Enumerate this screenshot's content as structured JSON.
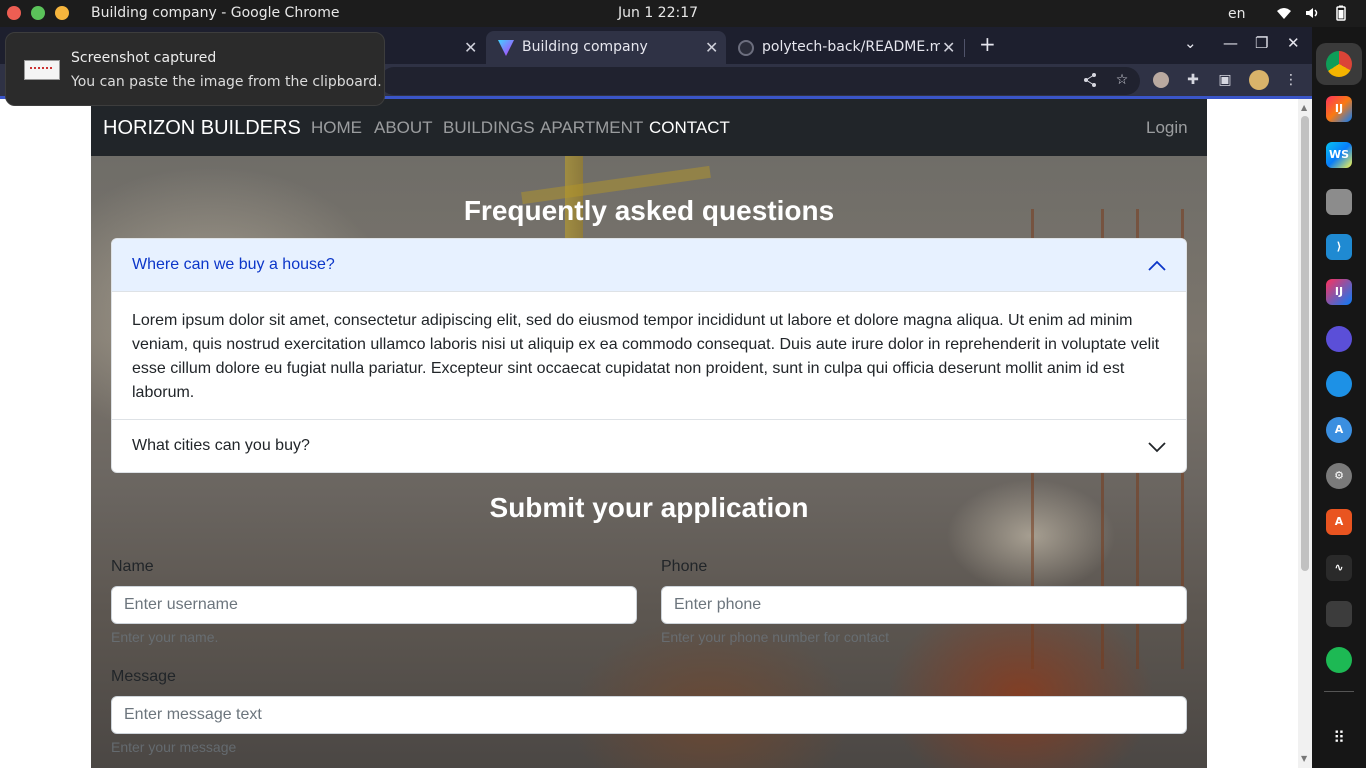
{
  "os": {
    "window_title": "Building company - Google Chrome",
    "clock": "Jun 1  22:17",
    "language": "en"
  },
  "browser": {
    "tabs": [
      {
        "label": ""
      },
      {
        "label": "Building company"
      },
      {
        "label": "polytech-back/README.md"
      }
    ],
    "new_tab_icon": "+"
  },
  "notification": {
    "title": "Screenshot captured",
    "body": "You can paste the image from the clipboard."
  },
  "site": {
    "brand": "HORIZON BUILDERS",
    "nav": [
      "HOME",
      "ABOUT",
      "BUILDINGS",
      "APARTMENT",
      "CONTACT"
    ],
    "login": "Login",
    "faq": {
      "title": "Frequently asked questions",
      "items": [
        {
          "question": "Where can we buy a house?",
          "answer": "Lorem ipsum dolor sit amet, consectetur adipiscing elit, sed do eiusmod tempor incididunt ut labore et dolore magna aliqua. Ut enim ad minim veniam, quis nostrud exercitation ullamco laboris nisi ut aliquip ex ea commodo consequat. Duis aute irure dolor in reprehenderit in voluptate velit esse cillum dolore eu fugiat nulla pariatur. Excepteur sint occaecat cupidatat non proident, sunt in culpa qui officia deserunt mollit anim id est laborum."
        },
        {
          "question": "What cities can you buy?"
        }
      ]
    },
    "form": {
      "title": "Submit your application",
      "name_label": "Name",
      "name_placeholder": "Enter username",
      "name_help": "Enter your name.",
      "phone_label": "Phone",
      "phone_placeholder": "Enter phone",
      "phone_help": "Enter your phone number for contact",
      "message_label": "Message",
      "message_placeholder": "Enter message text",
      "message_help": "Enter your message"
    }
  },
  "colors": {
    "nav_bg": "#212529",
    "accordion_active_bg": "#e7f1ff",
    "accordion_active_text": "#0c36c9",
    "browser_accent": "#3a55c8"
  },
  "icons": [
    "wifi-icon",
    "volume-icon",
    "battery-icon",
    "share-icon",
    "star-icon",
    "extensions-icon",
    "side-panel-icon",
    "menu-icon",
    "chevron-up-icon",
    "chevron-down-icon"
  ]
}
